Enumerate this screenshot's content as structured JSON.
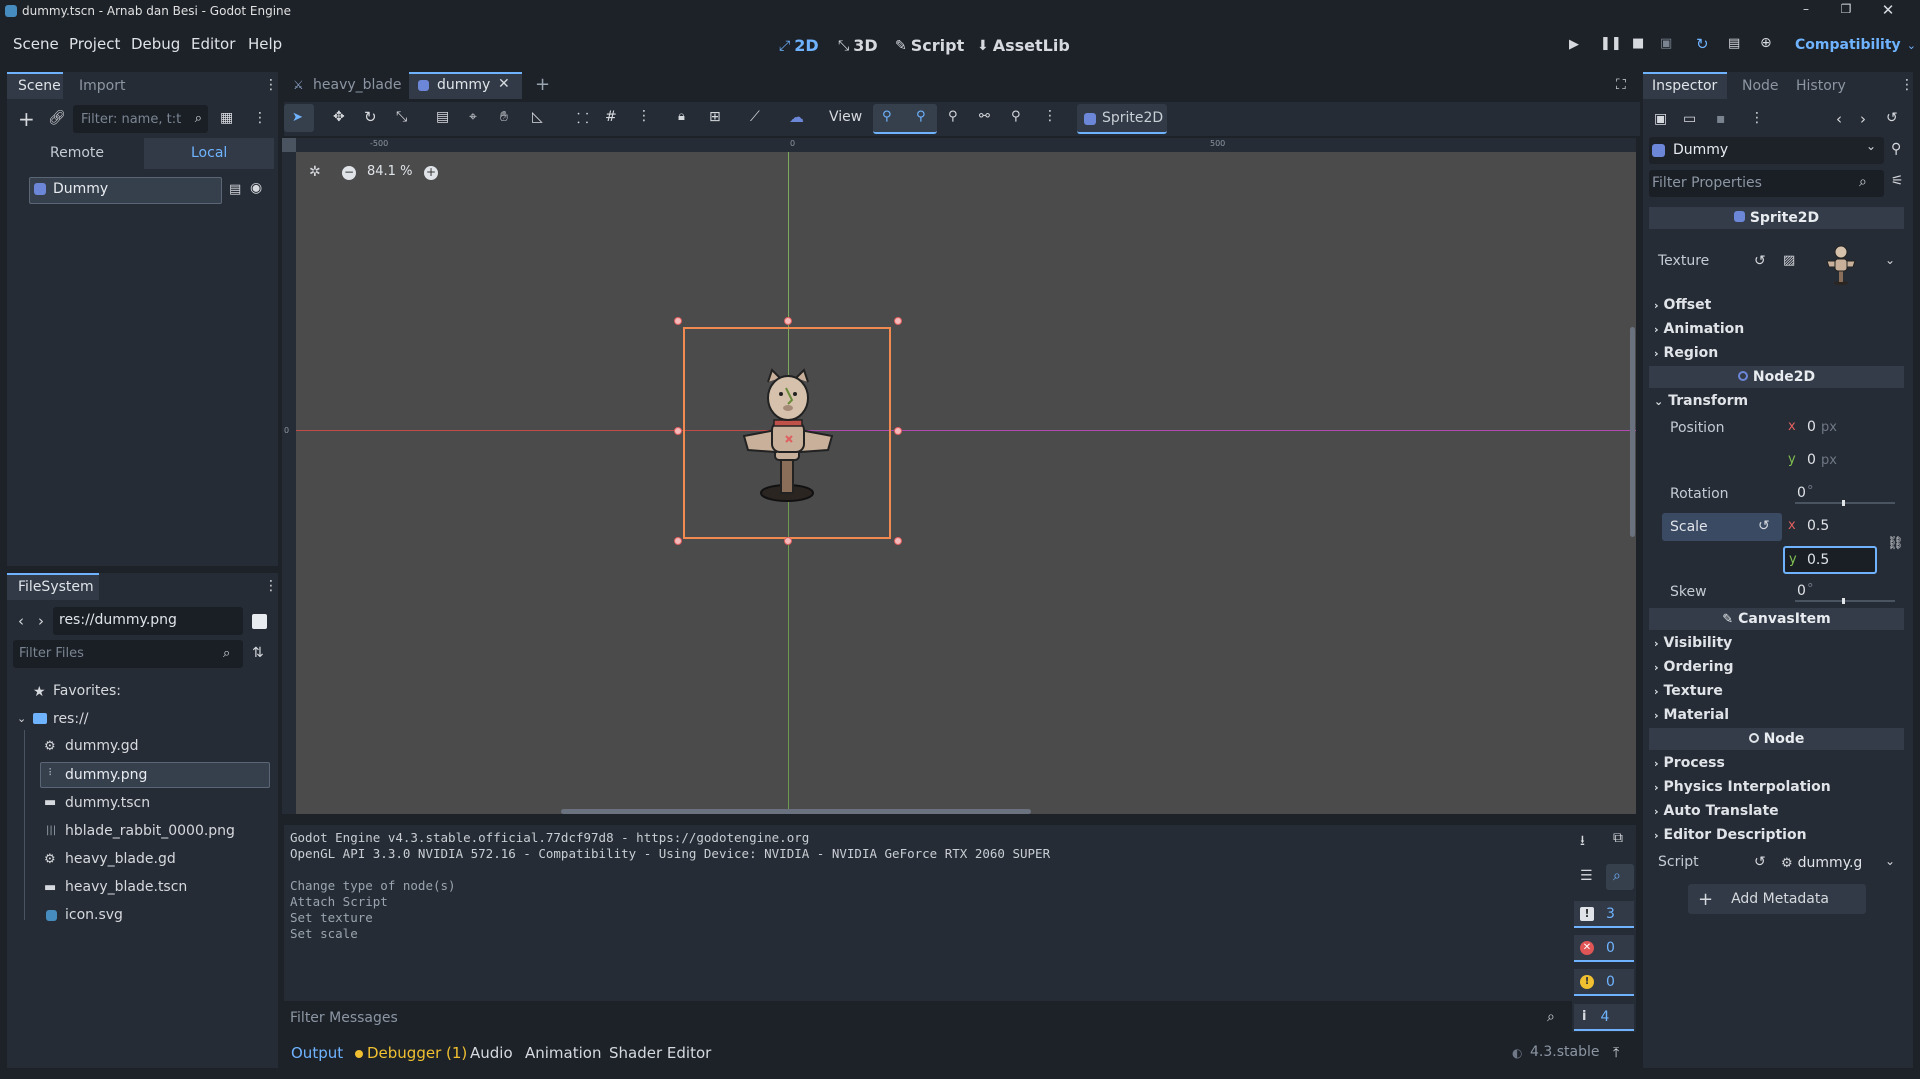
{
  "window": {
    "title": "dummy.tscn - Arnab dan Besi - Godot Engine"
  },
  "menu": [
    "Scene",
    "Project",
    "Debug",
    "Editor",
    "Help"
  ],
  "modes": [
    "2D",
    "3D",
    "Script",
    "AssetLib"
  ],
  "renderer": "Compatibility",
  "scene_dock": {
    "tabs": [
      "Scene",
      "Import"
    ],
    "filter_placeholder": "Filter: name, t:t",
    "remote": "Remote",
    "local": "Local",
    "root_node": "Dummy"
  },
  "filesystem": {
    "title": "FileSystem",
    "path": "res://dummy.png",
    "filter_placeholder": "Filter Files",
    "favorites": "Favorites:",
    "root": "res://",
    "files": [
      "dummy.gd",
      "dummy.png",
      "dummy.tscn",
      "hblade_rabbit_0000.png",
      "heavy_blade.gd",
      "heavy_blade.tscn",
      "icon.svg"
    ]
  },
  "editor_tabs": [
    "heavy_blade",
    "dummy"
  ],
  "toolbar": {
    "view": "View",
    "node_type": "Sprite2D"
  },
  "viewport": {
    "zoom": "84.1 %",
    "ruler": [
      "-500",
      "0",
      "500"
    ],
    "ruler_v": "0"
  },
  "output": {
    "lines": [
      "Godot Engine v4.3.stable.official.77dcf97d8 - https://godotengine.org",
      "OpenGL API 3.3.0 NVIDIA 572.16 - Compatibility - Using Device: NVIDIA - NVIDIA GeForce RTX 2060 SUPER",
      "",
      "Change type of node(s)",
      "Attach Script",
      "Set texture",
      "Set scale"
    ],
    "filter_placeholder": "Filter Messages",
    "counts": [
      "3",
      "0",
      "0",
      "4"
    ]
  },
  "bottom_tabs": [
    "Output",
    "Debugger (1)",
    "Audio",
    "Animation",
    "Shader Editor"
  ],
  "version": "4.3.stable",
  "inspector": {
    "tabs": [
      "Inspector",
      "Node",
      "History"
    ],
    "node": "Dummy",
    "filter_placeholder": "Filter Properties",
    "sprite2d": "Sprite2D",
    "texture_label": "Texture",
    "sprite_sections": [
      "Offset",
      "Animation",
      "Region"
    ],
    "node2d": "Node2D",
    "transform": "Transform",
    "position_label": "Position",
    "pos_x": "0",
    "pos_y": "0",
    "px": "px",
    "rotation_label": "Rotation",
    "rotation": "0",
    "deg": "°",
    "scale_label": "Scale",
    "scale_x": "0.5",
    "scale_y": "0.5",
    "skew_label": "Skew",
    "skew": "0",
    "axis_x": "x",
    "axis_y": "y",
    "canvasitem": "CanvasItem",
    "canvas_sections": [
      "Visibility",
      "Ordering",
      "Texture",
      "Material"
    ],
    "node_cat": "Node",
    "node_sections": [
      "Process",
      "Physics Interpolation",
      "Auto Translate",
      "Editor Description"
    ],
    "script_label": "Script",
    "script_value": "dummy.g",
    "add_metadata": "Add Metadata"
  }
}
